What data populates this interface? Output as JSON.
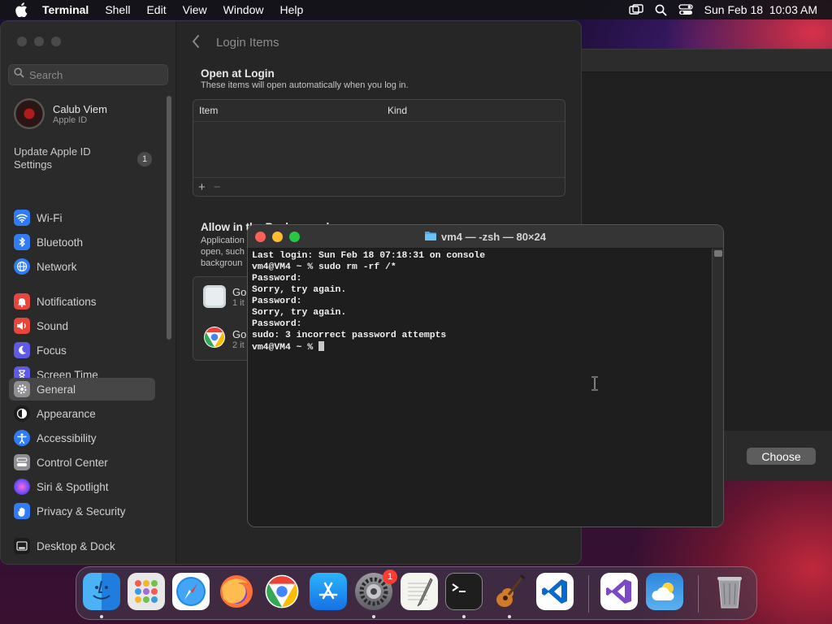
{
  "menubar": {
    "app": "Terminal",
    "items": [
      "Shell",
      "Edit",
      "View",
      "Window",
      "Help"
    ],
    "datetime": "Sun Feb 18  10:03 AM"
  },
  "sidebar": {
    "search_placeholder": "Search",
    "account": {
      "name": "Calub Viem",
      "sub": "Apple ID"
    },
    "update": {
      "label": "Update Apple ID Settings",
      "count": "1"
    },
    "items": [
      {
        "label": "Wi-Fi",
        "icon": "wifi-icon",
        "color": "#2f7cf6"
      },
      {
        "label": "Bluetooth",
        "icon": "bluetooth-icon",
        "color": "#2f7cf6"
      },
      {
        "label": "Network",
        "icon": "globe-icon",
        "color": "#2f7cf6"
      },
      {
        "label": "Notifications",
        "icon": "bell-icon",
        "color": "#e8453c"
      },
      {
        "label": "Sound",
        "icon": "speaker-icon",
        "color": "#e8453c"
      },
      {
        "label": "Focus",
        "icon": "moon-icon",
        "color": "#5e5ce6"
      },
      {
        "label": "Screen Time",
        "icon": "hourglass-icon",
        "color": "#5e5ce6"
      },
      {
        "label": "General",
        "icon": "gear-icon",
        "color": "#8e8e93"
      },
      {
        "label": "Appearance",
        "icon": "appearance-icon",
        "color": "#1c1c1e"
      },
      {
        "label": "Accessibility",
        "icon": "accessibility-icon",
        "color": "#2f7cf6"
      },
      {
        "label": "Control Center",
        "icon": "control-center-icon",
        "color": "#8e8e93"
      },
      {
        "label": "Siri & Spotlight",
        "icon": "siri-icon",
        "color": "#b94cc4"
      },
      {
        "label": "Privacy & Security",
        "icon": "hand-icon",
        "color": "#2f7cf6"
      },
      {
        "label": "Desktop & Dock",
        "icon": "dock-icon",
        "color": "#1c1c1e"
      }
    ]
  },
  "content": {
    "title": "Login Items",
    "open_at_login": {
      "title": "Open at Login",
      "subtitle": "These items will open automatically when you log in.",
      "col_item": "Item",
      "col_kind": "Kind",
      "add": "+",
      "remove": "−"
    },
    "background": {
      "title": "Allow in the Background",
      "text_lines": [
        "Application",
        "open, such",
        "backgroun"
      ],
      "rows": [
        {
          "name": "Go",
          "count": "1 it"
        },
        {
          "name": "Go",
          "count": "2 it"
        }
      ]
    }
  },
  "back_window": {
    "choose_label": "Choose"
  },
  "terminal": {
    "title": "vm4 — -zsh — 80×24",
    "lines": [
      "Last login: Sun Feb 18 07:18:31 on console",
      "vm4@VM4 ~ % sudo rm -rf /*",
      "Password:",
      "Sorry, try again.",
      "Password:",
      "Sorry, try again.",
      "Password:",
      "sudo: 3 incorrect password attempts",
      "vm4@VM4 ~ % "
    ]
  },
  "dock": {
    "apps": [
      {
        "name": "Finder",
        "icon": "finder-icon"
      },
      {
        "name": "Launchpad",
        "icon": "launchpad-icon"
      },
      {
        "name": "Safari",
        "icon": "safari-icon"
      },
      {
        "name": "Firefox",
        "icon": "firefox-icon"
      },
      {
        "name": "Chrome",
        "icon": "chrome-icon"
      },
      {
        "name": "App Store",
        "icon": "app-store-icon"
      },
      {
        "name": "System Settings",
        "icon": "system-settings-icon",
        "badge": "1"
      },
      {
        "name": "TextEdit",
        "icon": "textedit-icon"
      },
      {
        "name": "Terminal",
        "icon": "terminal-icon"
      },
      {
        "name": "GarageBand",
        "icon": "garageband-icon"
      },
      {
        "name": "Visual Studio Code",
        "icon": "vscode-icon"
      },
      {
        "name": "Visual Studio",
        "icon": "visual-studio-icon"
      },
      {
        "name": "Weather",
        "icon": "weather-icon"
      },
      {
        "name": "Trash",
        "icon": "trash-icon"
      }
    ]
  }
}
